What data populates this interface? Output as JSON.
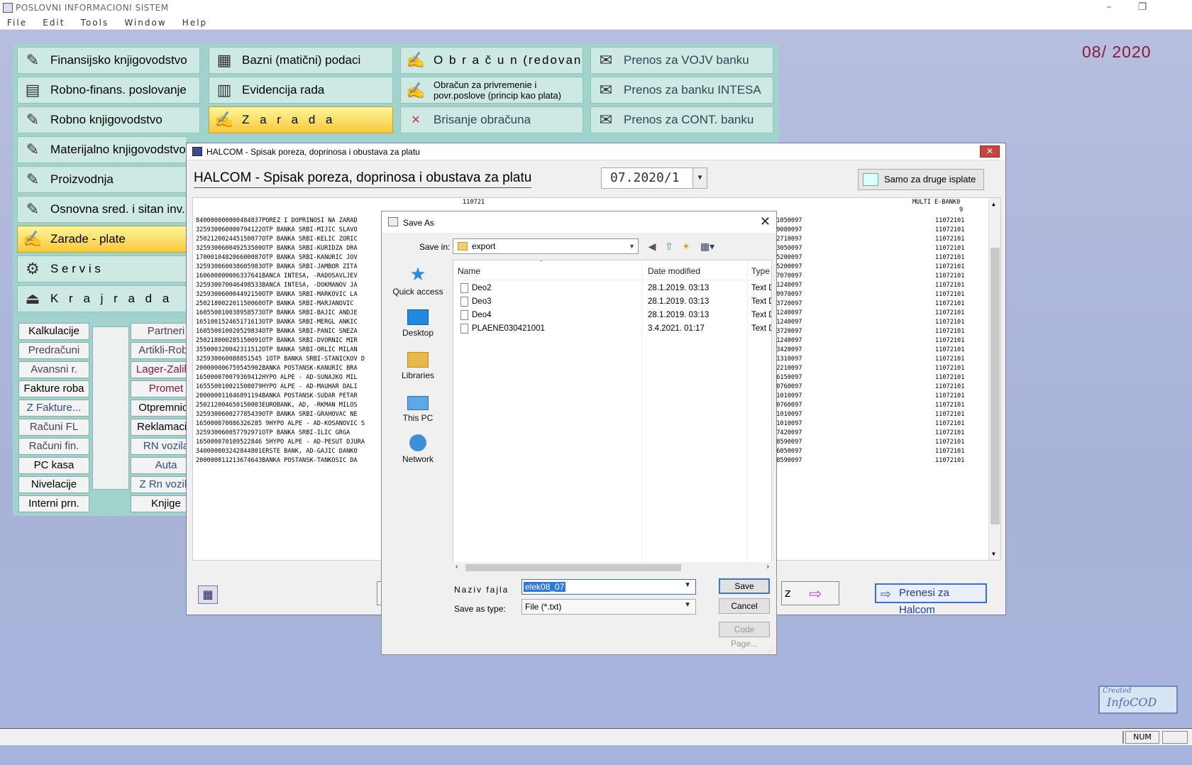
{
  "app": {
    "title": "POSLOVNI INFORMACIONI SISTEM",
    "menu": [
      "File",
      "Edit",
      "Tools",
      "Window",
      "Help"
    ],
    "period": "08/ 2020",
    "win_min": "–",
    "win_max": "❐"
  },
  "modules_col1": [
    "Finansijsko knjigovodstvo",
    "Robno-finans. poslovanje",
    "Robno knjigovodstvo",
    "Materijalno knjigovodstvo",
    "Proizvodnja",
    "Osnovna sred. i sitan inv.",
    "Zarade - plate",
    "S e r v i s",
    "K r a j   r a d a"
  ],
  "modules_col2": [
    "Bazni (matični) podaci",
    "Evidencija rada",
    "Z a r a d a"
  ],
  "modules_col3": [
    "O b r a č u n  (redovan)",
    "Obračun za privremenie i",
    "povr.poslove (princip kao plata)",
    "Brisanje obračuna"
  ],
  "modules_col4": [
    "Prenos za VOJV banku",
    "Prenos za banku INTESA",
    "Prenos za CONT. banku"
  ],
  "small_left": [
    "Kalkulacije",
    "Predračuni",
    "Avansni r.",
    "Fakture roba",
    "Z Fakture...",
    "Računi FL",
    "Računi fin.",
    "PC kasa",
    "Nivelacije",
    "Interni prn."
  ],
  "small_right": [
    "Partneri",
    "Artikli-Roba",
    "Lager-Zalihe",
    "Promet",
    "Otpremnice",
    "Reklamacije",
    "RN vozila",
    "Auta",
    "Z Rn vozila",
    "Knjige"
  ],
  "halcom": {
    "caption": "HALCOM - Spisak poreza, doprinosa i obustava za platu",
    "heading": "HALCOM - Spisak poreza, doprinosa i obustava za platu",
    "period": "07.2020/1",
    "samo_btn": "Samo za druge isplate",
    "prenesi_btn": "Prenesi za Halcom",
    "exit_label": "z",
    "header_line1_a": "110721",
    "header_line1_b": "MULTI E-BANK0",
    "header_line2": "9",
    "rows": [
      [
        "840000000000484837POREZ I DOPRINOSI NA ZARAD",
        "00005381050097",
        "11072101"
      ],
      [
        "325930060000794122OTP BANKA SRBI-MIJIC SLAVO",
        "00000339080097",
        "11072101"
      ],
      [
        "250212002445150077OTP BANKA SRBI-KELIC ZORIC",
        "00000352710097",
        "11072101"
      ],
      [
        "325930060049253500OTP BANKA SRBI-KURIDZA DRA",
        "00000333050097",
        "11072101"
      ],
      [
        "170001048206600087OTP BANKA SRBI-KANURIC JOV",
        "00000395200097",
        "11072101"
      ],
      [
        "325930060038605983OTP BANKA SRBI-JAMBOR ZITA",
        "00000395200097",
        "11072101"
      ],
      [
        "160600000006337641BANCA INTESA, -RADOSAVLJEV",
        "00000507070097",
        "11072101"
      ],
      [
        "325930070046498533BANCA INTESA, -DOKMANOV JA",
        "00000341240097",
        "11072101"
      ],
      [
        "325930060004492150OTP BANKA SRBI-MARKOVIC LA",
        "00000339970097",
        "11072101"
      ],
      [
        "250218002201150060OTP BANKA SRBI-MARJANOVIC ",
        "00000393720097",
        "11072101"
      ],
      [
        "160550010038958573OTP BANKA SRBI-BAJIC ANDJE",
        "00000341240097",
        "11072101"
      ],
      [
        "165100152465171613OTP BANKA SRBI-MERGL ANKIC",
        "00000341240097",
        "11072101"
      ],
      [
        "160550010020529834OTP BANKA SRBI-PANIC SNEZA",
        "00000393720097",
        "11072101"
      ],
      [
        "250218000285150091OTP BANKA SRBI-DVORNIC MIR",
        "00000341240097",
        "11072101"
      ],
      [
        "355000320042311512OTP BANKA SRBI-ORLIC MILAN",
        "00000323420097",
        "11072101"
      ],
      [
        "325930060088851545 1OTP BANKA SRBI-STANICKOV D",
        "00000351310097",
        "11072101"
      ],
      [
        "200000006759545902BANKA POSTANSK-KANURIC BRA",
        "00000322210097",
        "11072101"
      ],
      [
        "165000070079369412HYPO ALPE - AD-SUNAJKO MIL",
        "00000336150097",
        "11072101"
      ],
      [
        "165550010021508079HYPO ALPE - AD-MAUHAR DALI",
        "00000390760097",
        "11072101"
      ],
      [
        "200000011046891194BANKA POSTANSK-SUDAR PETAR",
        "00000321010097",
        "11072101"
      ],
      [
        "250212004650150003EUROBANK, AD, -RKMAN MILOS",
        "00000390760097",
        "11072101"
      ],
      [
        "325930060027785439OTP BANKA SRBI-GRAHOVAC NE",
        "00000321010097",
        "11072101"
      ],
      [
        "165000070086326285 9HYPO ALPE - AD-KOSANOVIC S",
        "00000321010097",
        "11072101"
      ],
      [
        "325930060057792971OTP BANKA SRBI-ILIC GRGA ",
        "00000337420097",
        "11072101"
      ],
      [
        "165000070109522846 5HYPO ALPE - AD-PESUT DJURA",
        "00000318590097",
        "11072101"
      ],
      [
        "340000003242844801ERSTE BANK, AD-GAJIC DANKO",
        "00000346050097",
        "11072101"
      ],
      [
        "200000011213674643BANKA POSTANSK-TANKOSIC DA",
        "00000318590097",
        "11072101"
      ]
    ]
  },
  "saveas": {
    "caption": "Save As",
    "save_in_label": "Save in:",
    "save_in_value": "export",
    "places": [
      "Quick access",
      "Desktop",
      "Libraries",
      "This PC",
      "Network"
    ],
    "columns": [
      "Name",
      "Date modified",
      "Type"
    ],
    "files": [
      {
        "name": "Deo2",
        "date": "28.1.2019. 03:13",
        "type": "Text D"
      },
      {
        "name": "Deo3",
        "date": "28.1.2019. 03:13",
        "type": "Text D"
      },
      {
        "name": "Deo4",
        "date": "28.1.2019. 03:13",
        "type": "Text D"
      },
      {
        "name": "PLAENE030421001",
        "date": "3.4.2021. 01:17",
        "type": "Text D"
      }
    ],
    "filename_label": "Naziv fajla",
    "filename_value": "elek08_07",
    "type_label": "Save as type:",
    "type_value": "File (*.txt)",
    "save_btn": "Save",
    "cancel_btn": "Cancel",
    "codepage_btn": "Code Page..."
  },
  "status": {
    "num": "NUM"
  },
  "logo": {
    "line1": "Created",
    "line2": "InfoCOD"
  }
}
